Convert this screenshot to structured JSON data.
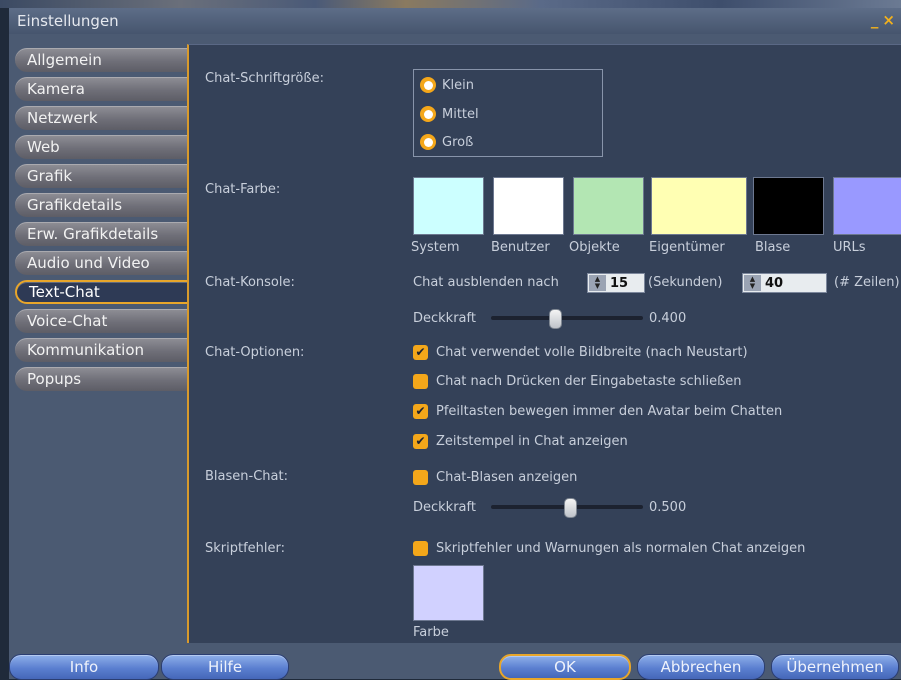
{
  "window": {
    "title": "Einstellungen"
  },
  "tabs": [
    "Allgemein",
    "Kamera",
    "Netzwerk",
    "Web",
    "Grafik",
    "Grafikdetails",
    "Erw. Grafikdetails",
    "Audio und Video",
    "Text-Chat",
    "Voice-Chat",
    "Kommunikation",
    "Popups"
  ],
  "active_tab": "Text-Chat",
  "font_size": {
    "label": "Chat-Schriftgröße:",
    "options": [
      "Klein",
      "Mittel",
      "Groß"
    ],
    "selected": "Mittel"
  },
  "chat_color": {
    "label": "Chat-Farbe:",
    "swatches": [
      {
        "name": "System",
        "color": "#ccffff"
      },
      {
        "name": "Benutzer",
        "color": "#ffffff"
      },
      {
        "name": "Objekte",
        "color": "#b3e6b3"
      },
      {
        "name": "Eigentümer",
        "color": "#ffffb3"
      },
      {
        "name": "Blase",
        "color": "#000000"
      },
      {
        "name": "URLs",
        "color": "#9999ff"
      }
    ]
  },
  "console": {
    "label": "Chat-Konsole:",
    "fade_label": "Chat ausblenden nach",
    "fade_value": "15",
    "seconds_label": "(Sekunden)",
    "lines_value": "40",
    "lines_label": "(# Zeilen)",
    "opacity_label": "Deckkraft",
    "opacity_value": "0.400",
    "opacity_fraction": 0.4
  },
  "options": {
    "label": "Chat-Optionen:",
    "items": [
      {
        "text": "Chat verwendet volle Bildbreite (nach Neustart)",
        "checked": true
      },
      {
        "text": "Chat nach Drücken der Eingabetaste schließen",
        "checked": false
      },
      {
        "text": "Pfeiltasten bewegen immer den Avatar beim Chatten",
        "checked": true
      },
      {
        "text": "Zeitstempel in Chat anzeigen",
        "checked": true
      }
    ]
  },
  "bubble": {
    "label": "Blasen-Chat:",
    "show_text": "Chat-Blasen anzeigen",
    "checked": false,
    "opacity_label": "Deckkraft",
    "opacity_value": "0.500",
    "opacity_fraction": 0.5
  },
  "script_errors": {
    "label": "Skriptfehler:",
    "text": "Skriptfehler und Warnungen als normalen Chat anzeigen",
    "checked": false,
    "color_label": "Farbe",
    "color": "#d1d1ff"
  },
  "buttons": {
    "info": "Info",
    "help": "Hilfe",
    "ok": "OK",
    "cancel": "Abbrechen",
    "apply": "Übernehmen"
  },
  "colors": {
    "accent": "#e8a62a",
    "button": "#5b7fd0",
    "panel": "#344158"
  }
}
